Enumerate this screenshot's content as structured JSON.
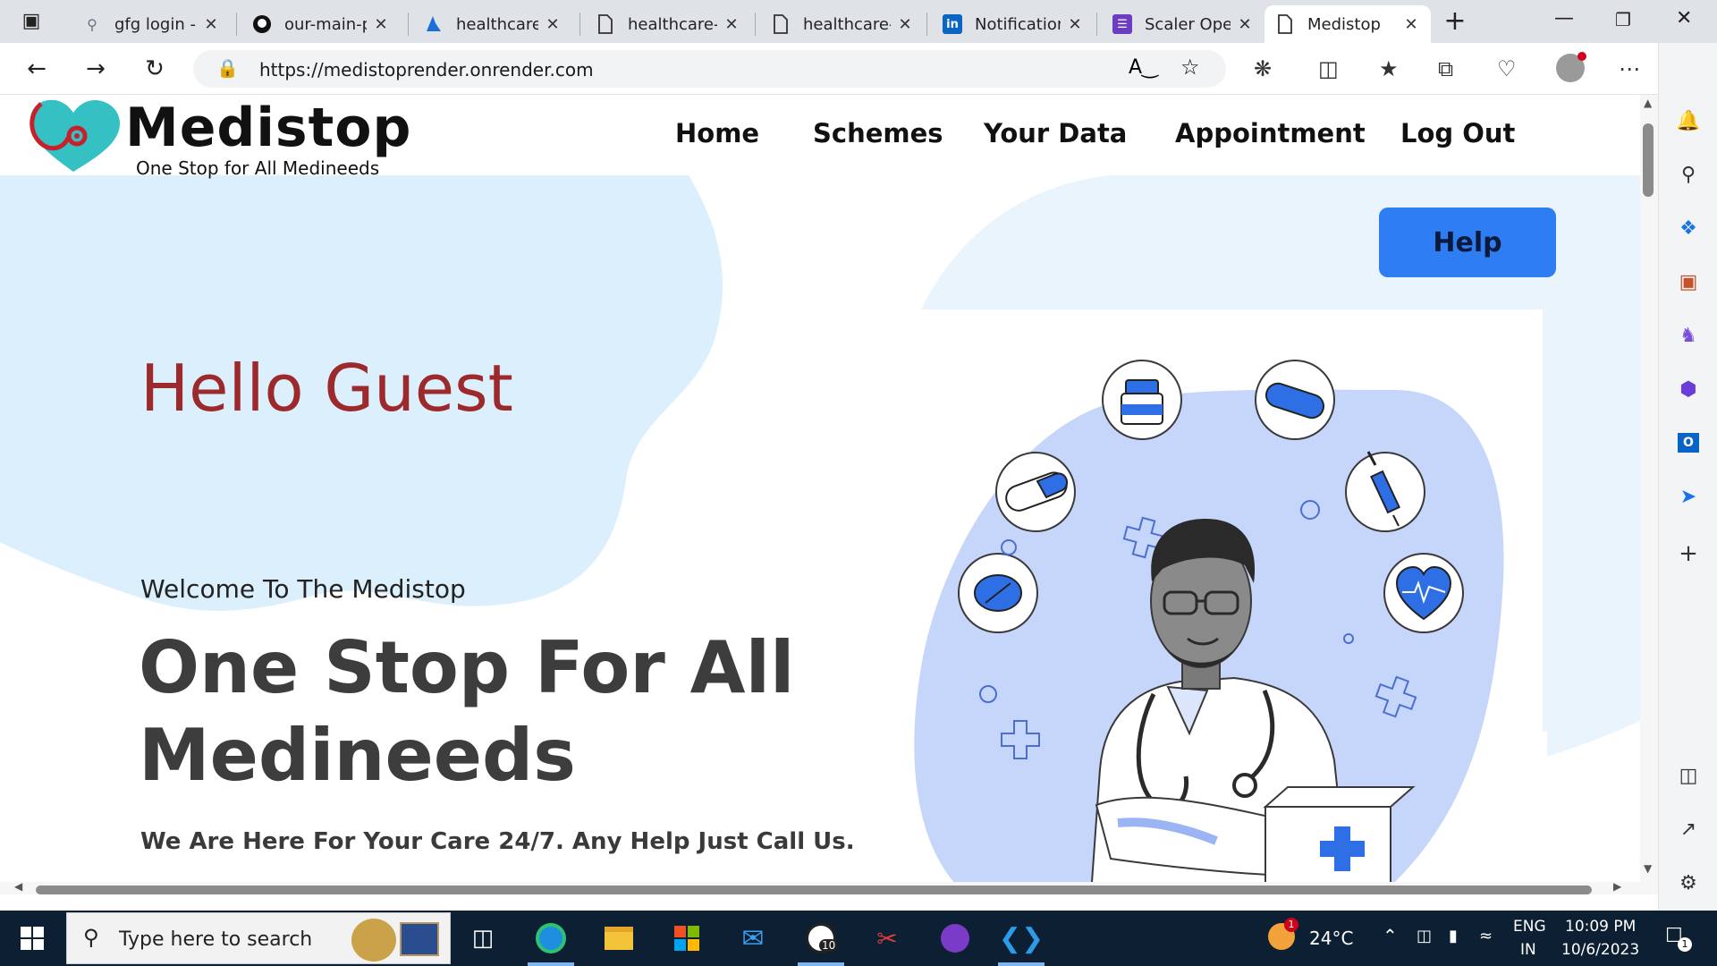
{
  "browser": {
    "tabs": [
      {
        "title": "gfg login - S",
        "icon": "search-icon",
        "active": false
      },
      {
        "title": "our-main-p",
        "icon": "github-icon",
        "active": false
      },
      {
        "title": "healthcare-l",
        "icon": "azure-icon",
        "active": false
      },
      {
        "title": "healthcare-l",
        "icon": "page-icon",
        "active": false
      },
      {
        "title": "healthcare-l",
        "icon": "page-icon",
        "active": false
      },
      {
        "title": "Notification",
        "icon": "linkedin-icon",
        "active": false
      },
      {
        "title": "Scaler Oper",
        "icon": "scaler-icon",
        "active": false
      },
      {
        "title": "Medistop",
        "icon": "page-icon",
        "active": true
      }
    ],
    "url": "https://medistoprender.onrender.com"
  },
  "site": {
    "logo_text": "Medistop",
    "tagline": "One Stop for All Medineeds",
    "nav": [
      "Home",
      "Schemes",
      "Your Data",
      "Appointment",
      "Log Out"
    ],
    "help_label": "Help",
    "greeting": "Hello Guest",
    "welcome": "Welcome To The Medistop",
    "headline_1": "One Stop For All",
    "headline_2": "Medineeds",
    "subline": "We Are Here For Your Care 24/7. Any Help Just Call Us."
  },
  "taskbar": {
    "search_placeholder": "Type here to search",
    "weather": "24°C",
    "weather_badge": "1",
    "lang_1": "ENG",
    "lang_2": "IN",
    "time": "10:09 PM",
    "date": "10/6/2023",
    "notif_count": "1",
    "whatsapp_badge": "10"
  },
  "colors": {
    "accent_blue": "#2f7df2",
    "greeting_red": "#9c2a2c",
    "blob_light": "#dbeffc",
    "illustration_blue": "#c6d6fb"
  }
}
